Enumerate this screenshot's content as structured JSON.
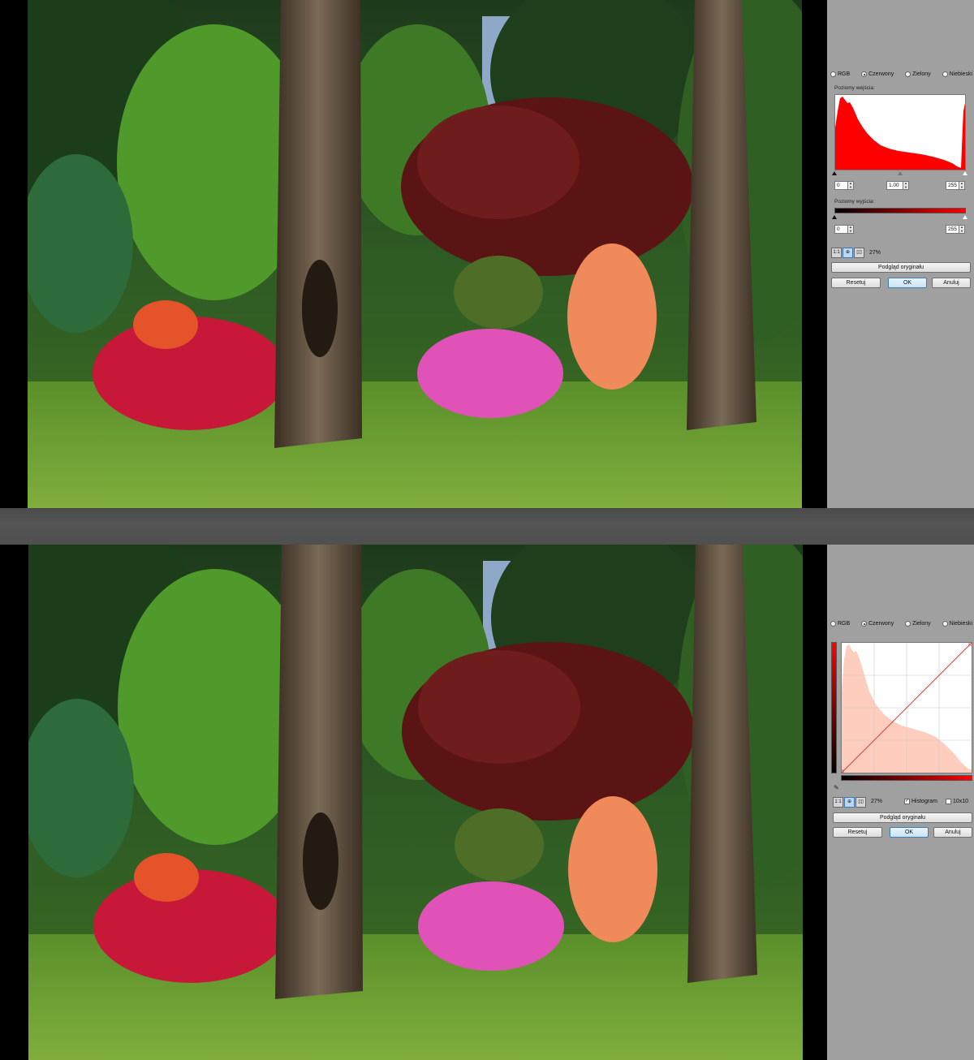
{
  "levels": {
    "channels": [
      "RGB",
      "Czerwony",
      "Zielony",
      "Niebieski"
    ],
    "selected_channel": "Czerwony",
    "input_levels_label": "Poziomy wejścia:",
    "input_black": "0",
    "input_gamma": "1.00",
    "input_white": "255",
    "output_levels_label": "Poziomy wyjścia:",
    "output_black": "0",
    "output_white": "255",
    "zoom_buttons": [
      "1:1",
      "⊕",
      "▯▯"
    ],
    "zoom": "27%",
    "preview_original": "Podgląd oryginału",
    "reset": "Resetuj",
    "ok": "OK",
    "cancel": "Anuluj",
    "histogram_color": "#ff0000"
  },
  "curves": {
    "channels": [
      "RGB",
      "Czerwony",
      "Zielony",
      "Niebieski"
    ],
    "selected_channel": "Czerwony",
    "zoom_buttons": [
      "1:1",
      "⊕",
      "▯▯"
    ],
    "zoom": "27%",
    "histogram_checkbox": "Histogram",
    "histogram_checked": true,
    "grid_checkbox": "10x10",
    "grid_checked": false,
    "preview_original": "Podgląd oryginału",
    "reset": "Resetuj",
    "ok": "OK",
    "cancel": "Anuluj",
    "histogram_color": "#ffcdbd",
    "curve_color": "#d04040"
  },
  "icons": {
    "eyedropper": "eyedropper-icon"
  }
}
